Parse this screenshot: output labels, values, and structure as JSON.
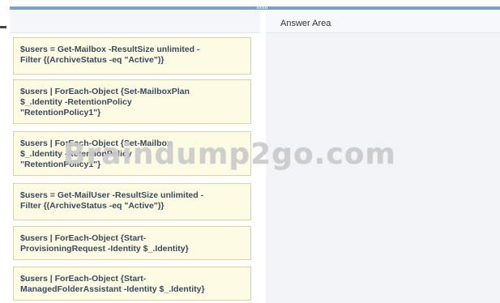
{
  "answer_area": {
    "title": "Answer Area"
  },
  "choices": [
    "$users = Get-Mailbox -ResultSize unlimited -\nFilter {(ArchiveStatus -eq \"Active\")}",
    "$users | ForEach-Object {Set-MailboxPlan\n$_.Identity -RetentionPolicy\n\"RetentionPolicy1\"}",
    "$users | ForEach-Object {Set-Mailbox\n$_.Identity -RetentionPolicy\n\"RetentionPolicy1\"}",
    "$users = Get-MailUser -ResultSize unlimited -\nFilter {(ArchiveStatus -eq \"Active\")}",
    "$users | ForEach-Object {Start-\nProvisioningRequest -Identity $_.Identity}",
    "$users | ForEach-Object {Start-\nManagedFolderAssistant -Identity $_.Identity}"
  ],
  "watermark": "Braindump2go.com",
  "colors": {
    "top_bar": "#7aa0c8",
    "choice_background": "#fdfbe3",
    "choice_border": "#d9d4a8",
    "choice_text": "#3a4a5e",
    "answer_area_background": "#f2f4f7"
  }
}
